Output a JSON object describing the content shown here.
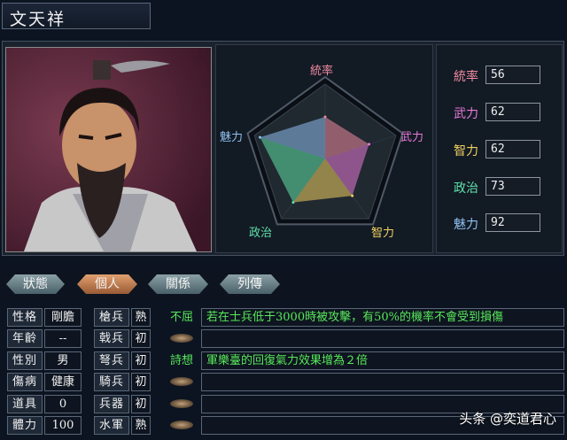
{
  "officer": {
    "name": "文天祥"
  },
  "radar": {
    "labels": {
      "tongshuai": "統率",
      "wuli": "武力",
      "zhili": "智力",
      "zhengzhi": "政治",
      "meili": "魅力"
    },
    "values": {
      "tongshuai": 56,
      "wuli": 62,
      "zhili": 62,
      "zhengzhi": 73,
      "meili": 92
    },
    "max": 100
  },
  "stats": [
    {
      "label": "統率",
      "value": "56",
      "color": "#f08aa0"
    },
    {
      "label": "武力",
      "value": "62",
      "color": "#e87ad8"
    },
    {
      "label": "智力",
      "value": "62",
      "color": "#f0d060"
    },
    {
      "label": "政治",
      "value": "73",
      "color": "#60e0a8"
    },
    {
      "label": "魅力",
      "value": "92",
      "color": "#90c0f0"
    }
  ],
  "tabs": [
    {
      "label": "狀態"
    },
    {
      "label": "個人"
    },
    {
      "label": "關係"
    },
    {
      "label": "列傳"
    }
  ],
  "personal": {
    "rows": [
      {
        "label": "性格",
        "value": "剛膽"
      },
      {
        "label": "年齡",
        "value": "--"
      },
      {
        "label": "性別",
        "value": "男"
      },
      {
        "label": "傷病",
        "value": "健康"
      },
      {
        "label": "道具",
        "value": "0"
      },
      {
        "label": "體力",
        "value": "100"
      }
    ]
  },
  "troops": {
    "rows": [
      {
        "label": "槍兵",
        "value": "熟"
      },
      {
        "label": "戟兵",
        "value": "初"
      },
      {
        "label": "弩兵",
        "value": "初"
      },
      {
        "label": "騎兵",
        "value": "初"
      },
      {
        "label": "兵器",
        "value": "初"
      },
      {
        "label": "水軍",
        "value": "熟"
      }
    ]
  },
  "skills": [
    {
      "name": "不屈",
      "desc": "若在士兵低于3000時被攻擊，有50%的機率不會受到損傷"
    },
    {
      "name": "",
      "desc": ""
    },
    {
      "name": "詩想",
      "desc": "軍樂臺的回復氣力效果增為２倍"
    },
    {
      "name": "",
      "desc": ""
    },
    {
      "name": "",
      "desc": ""
    },
    {
      "name": "",
      "desc": ""
    }
  ],
  "watermark": "头条 @奕道君心",
  "colors": {
    "skill_text": "#58e85a",
    "active_tab": "#e0a070"
  }
}
